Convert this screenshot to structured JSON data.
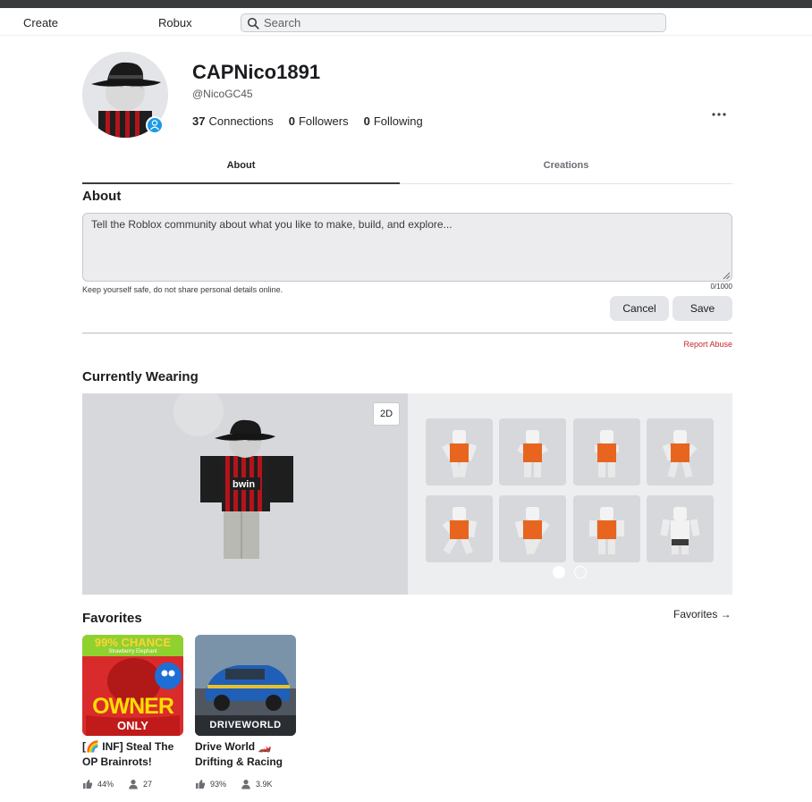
{
  "nav": {
    "create": "Create",
    "robux": "Robux"
  },
  "search": {
    "placeholder": "Search"
  },
  "profile": {
    "display_name": "CAPNico1891",
    "username": "@NicoGC45",
    "connections_count": "37",
    "connections_label": "Connections",
    "followers_count": "0",
    "followers_label": "Followers",
    "following_count": "0",
    "following_label": "Following"
  },
  "tabs": {
    "about": "About",
    "creations": "Creations"
  },
  "about": {
    "title": "About",
    "placeholder": "Tell the Roblox community about what you like to make, build, and explore...",
    "safety_note": "Keep yourself safe, do not share personal details online.",
    "char_count": "0/1000",
    "cancel": "Cancel",
    "save": "Save",
    "report_abuse": "Report Abuse"
  },
  "wearing": {
    "title": "Currently Wearing",
    "toggle_2d": "2D",
    "shirt_text": "bwin"
  },
  "favorites": {
    "title": "Favorites",
    "link": "Favorites →",
    "games": [
      {
        "name": "[🌈 INF] Steal The OP Brainrots!",
        "thumb_top": "99% CHANCE",
        "thumb_sub": "Strawberry Elephant",
        "thumb_owner": "OWNER",
        "thumb_only": "ONLY",
        "rating": "44%",
        "players": "27"
      },
      {
        "name": "Drive World 🏎️ Drifting & Racing",
        "thumb_brand": "DRIVEWORLD",
        "rating": "93%",
        "players": "3.9K"
      }
    ]
  },
  "colors": {
    "accent_blue": "#1a9ae8",
    "report_red": "#c4282d",
    "jersey_red": "#b3141c",
    "emote_orange": "#e8651f"
  }
}
